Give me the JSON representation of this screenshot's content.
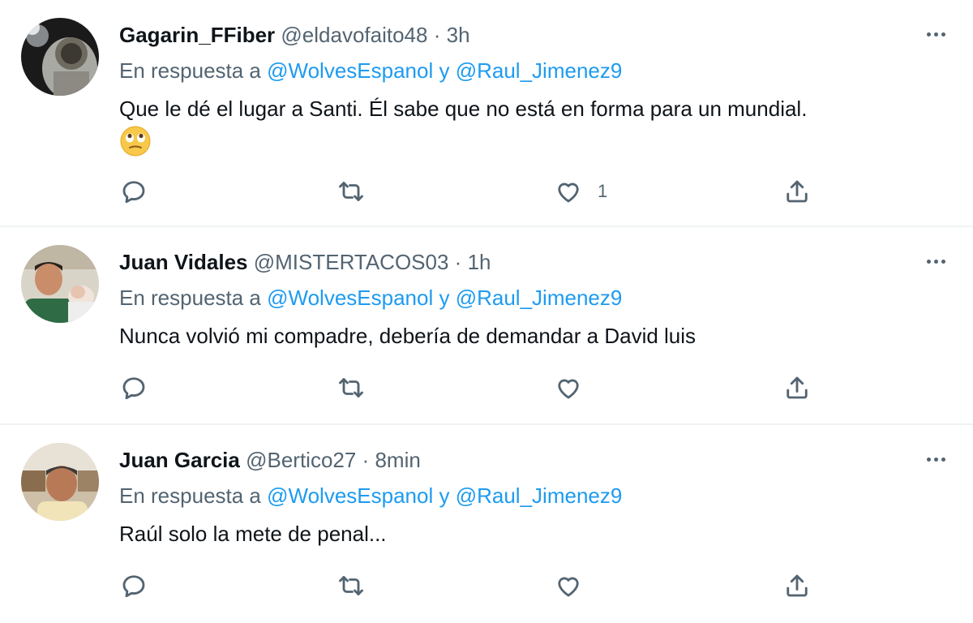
{
  "tweets": [
    {
      "name": "Gagarin_FFiber",
      "handle": "@eldavofaito48",
      "separator": "·",
      "time": "3h",
      "reply_prefix": "En respuesta a",
      "mention1": "@WolvesEspanol",
      "conjunction": "y",
      "mention2": "@Raul_Jimenez9",
      "text": "Que le dé el lugar a Santi. Él sabe que no está en forma para un mundial.",
      "emoji": "🙄",
      "likes": "1",
      "avatar_icon": "astronaut-avatar"
    },
    {
      "name": "Juan Vidales",
      "handle": "@MISTERTACOS03",
      "separator": "·",
      "time": "1h",
      "reply_prefix": "En respuesta a",
      "mention1": "@WolvesEspanol",
      "conjunction": "y",
      "mention2": "@Raul_Jimenez9",
      "text": "Nunca volvió mi compadre, debería de demandar a David luis",
      "likes": "",
      "avatar_icon": "man-with-baby-avatar"
    },
    {
      "name": "Juan Garcia",
      "handle": "@Bertico27",
      "separator": "·",
      "time": "8min",
      "reply_prefix": "En respuesta a",
      "mention1": "@WolvesEspanol",
      "conjunction": "y",
      "mention2": "@Raul_Jimenez9",
      "text": "Raúl solo la mete de penal...",
      "likes": "",
      "avatar_icon": "man-portrait-avatar"
    }
  ],
  "icons": {
    "more": "more-dots-icon",
    "reply": "reply-bubble-icon",
    "retweet": "retweet-icon",
    "like": "heart-icon",
    "share": "share-upload-icon"
  },
  "colors": {
    "text": "#0f1419",
    "muted": "#536471",
    "mention": "#1d9bf0",
    "divider": "#eff3f4"
  }
}
